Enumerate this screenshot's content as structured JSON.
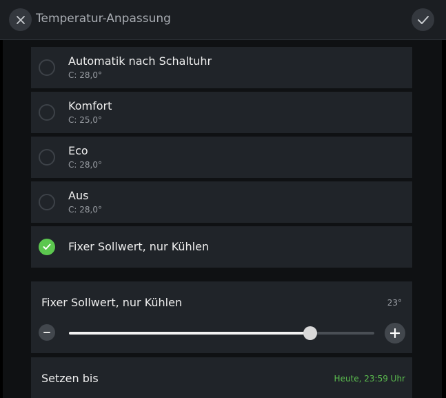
{
  "header": {
    "title": "Temperatur-Anpassung",
    "close_icon": "close-icon",
    "confirm_icon": "checkmark-icon"
  },
  "options": [
    {
      "label": "Automatik nach Schaltuhr",
      "sub": "C: 28,0°",
      "selected": false
    },
    {
      "label": "Komfort",
      "sub": "C: 25,0°",
      "selected": false
    },
    {
      "label": "Eco",
      "sub": "C: 28,0°",
      "selected": false
    },
    {
      "label": "Aus",
      "sub": "C: 28,0°",
      "selected": false
    },
    {
      "label": "Fixer Sollwert, nur Kühlen",
      "sub": "",
      "selected": true
    }
  ],
  "setpoint": {
    "title": "Fixer Sollwert, nur Kühlen",
    "value": "23°",
    "slider_fraction": 0.79
  },
  "until": {
    "label": "Setzen bis",
    "value": "Heute, 23:59 Uhr"
  },
  "colors": {
    "accent_green": "#5cc74f",
    "panel_bg": "#202429",
    "background": "#0f1113"
  }
}
